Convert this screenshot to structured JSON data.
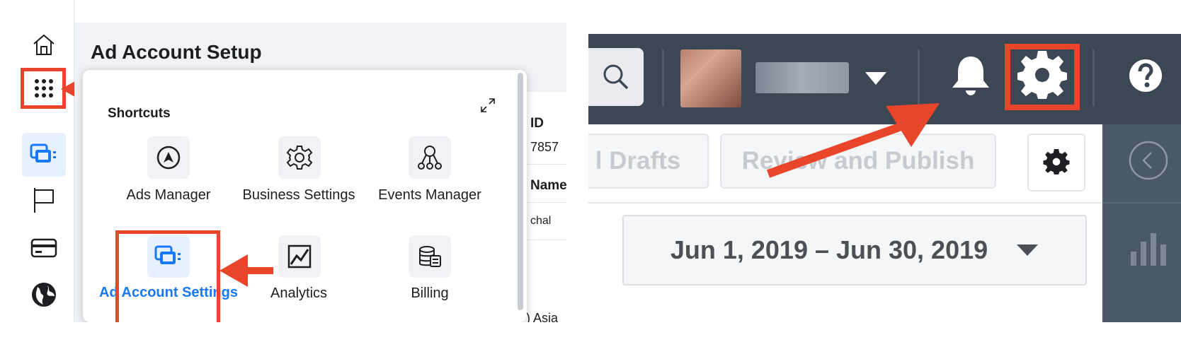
{
  "left": {
    "page_title": "Ad Account Setup",
    "rail_icons": [
      "home-icon",
      "apps-grid-icon",
      "ad-accounts-icon",
      "flag-icon",
      "credit-card-icon",
      "globe-icon"
    ],
    "table_peek": {
      "col1_header": "ID",
      "col1_value": "7857",
      "col2_header": "Name",
      "col2_value": "chal",
      "row3_value": ") Asia"
    },
    "shortcuts": {
      "title": "Shortcuts",
      "items": [
        {
          "label": "Ads Manager",
          "icon": "ads-manager-icon"
        },
        {
          "label": "Business Settings",
          "icon": "gear-icon"
        },
        {
          "label": "Events Manager",
          "icon": "events-manager-icon"
        },
        {
          "label": "Ad Account Settings",
          "icon": "ad-account-settings-icon"
        },
        {
          "label": "Analytics",
          "icon": "analytics-icon"
        },
        {
          "label": "Billing",
          "icon": "billing-icon"
        }
      ]
    }
  },
  "right": {
    "buttons": {
      "drafts": "l Drafts",
      "review": "Review and Publish"
    },
    "date_range": "Jun 1, 2019 – Jun 30, 2019"
  },
  "colors": {
    "highlight": "#e8452b",
    "topbar": "#3c4753",
    "accent_blue": "#1877f2"
  }
}
